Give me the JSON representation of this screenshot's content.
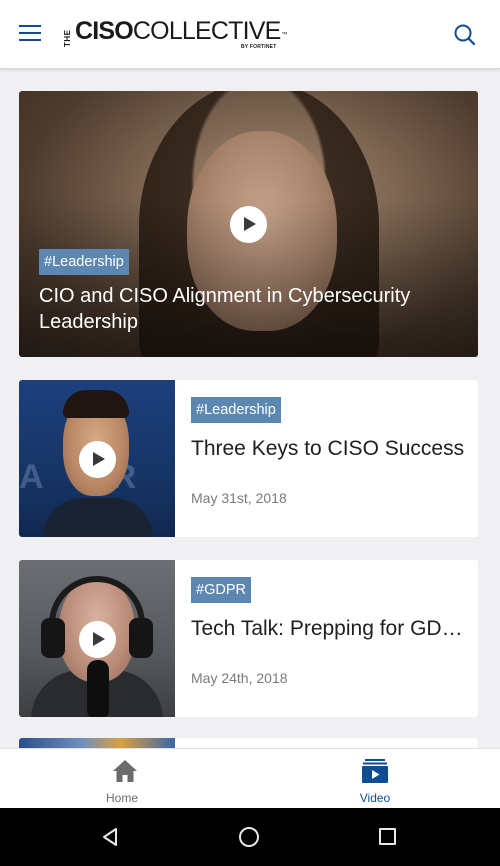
{
  "header": {
    "logo_the": "THE",
    "logo_bold": "CISO",
    "logo_light": "COLLECTIVE",
    "logo_tm": "™",
    "logo_by": "BY FORTINET",
    "menu_icon": "hamburger-menu-icon",
    "search_icon": "search-icon"
  },
  "hero": {
    "tag": "#Leadership",
    "title": "CIO and CISO Alignment in Cybersecurity Leadership"
  },
  "cards": [
    {
      "tag": "#Leadership",
      "title": "Three Keys to CISO Success",
      "date": "May 31st, 2018"
    },
    {
      "tag": "#GDPR",
      "title": "Tech Talk: Prepping for GDPR",
      "date": "May 24th, 2018"
    }
  ],
  "bottom_nav": {
    "home_label": "Home",
    "video_label": "Video",
    "active": "Video"
  },
  "colors": {
    "brand_blue": "#0e4d92",
    "tag_bg": "#5b87b0",
    "page_bg": "#f0f0f3"
  }
}
